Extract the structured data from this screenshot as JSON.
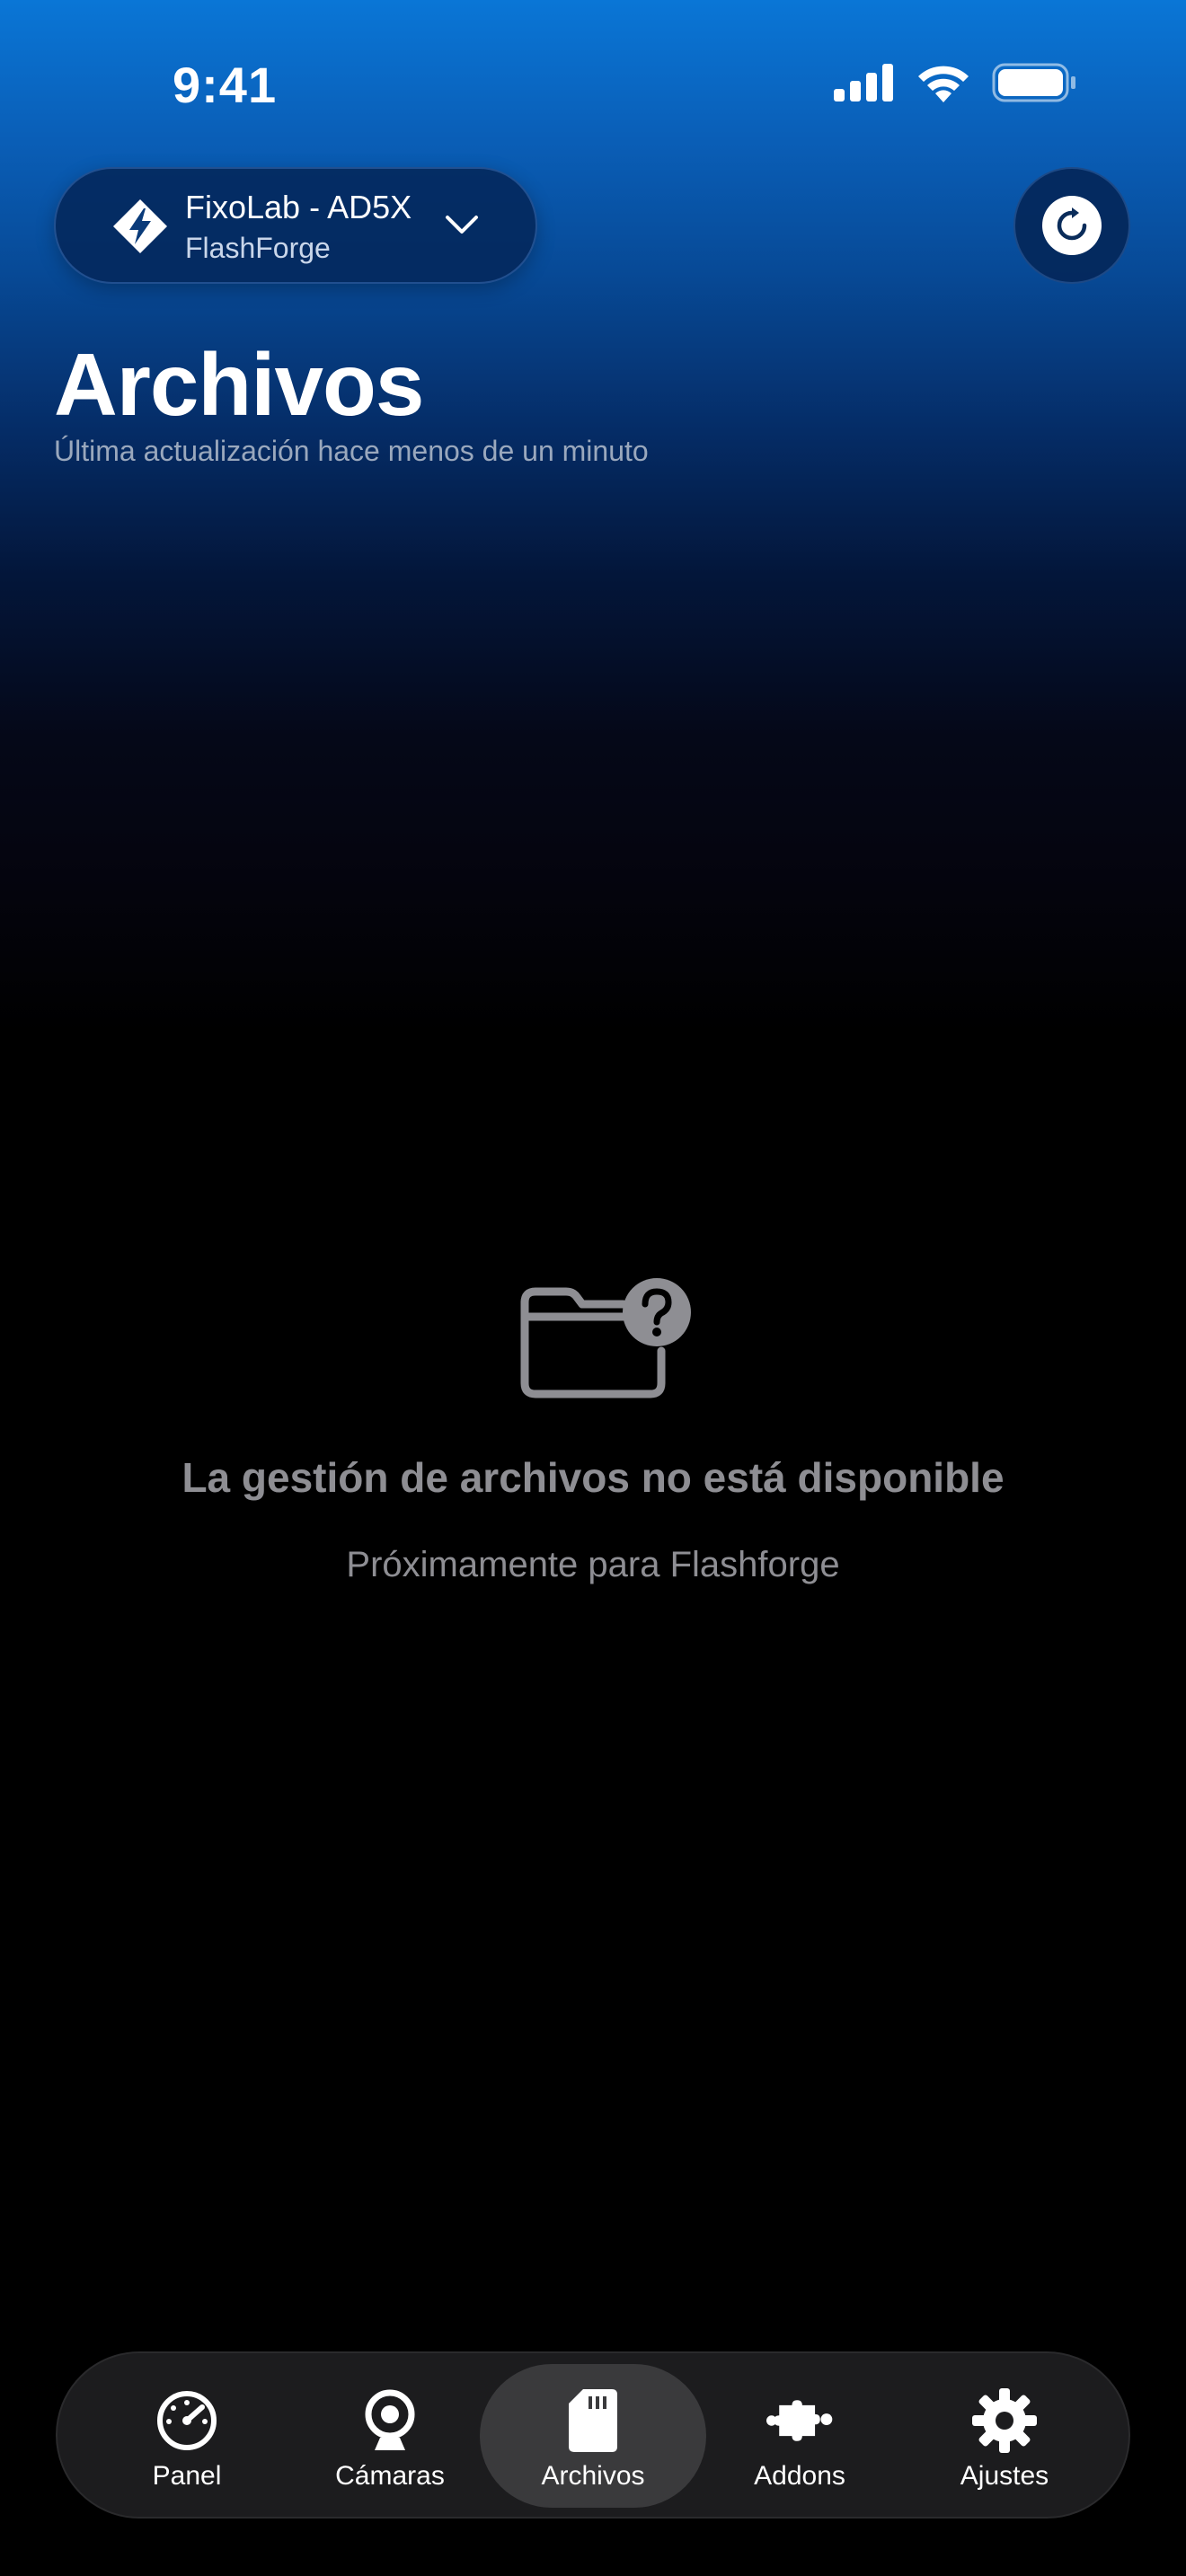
{
  "status_bar": {
    "time": "9:41",
    "icons": [
      "cellular-signal-icon",
      "wifi-icon",
      "battery-icon"
    ]
  },
  "printer_selector": {
    "name": "FixoLab - AD5X",
    "brand": "FlashForge",
    "logo_icon": "flashforge-logo-icon",
    "chevron_icon": "chevron-down-icon"
  },
  "refresh": {
    "icon": "refresh-icon"
  },
  "page": {
    "title": "Archivos",
    "subtitle": "Última actualización hace menos de un minuto"
  },
  "empty_state": {
    "icon": "folder-question-icon",
    "title": "La gestión de archivos no está disponible",
    "subtitle": "Próximamente para Flashforge"
  },
  "tab_bar": {
    "active_tab": "Archivos",
    "tabs": [
      {
        "label": "Panel",
        "icon": "speedometer-icon"
      },
      {
        "label": "Cámaras",
        "icon": "webcam-icon"
      },
      {
        "label": "Archivos",
        "icon": "sd-card-icon"
      },
      {
        "label": "Addons",
        "icon": "puzzle-icon"
      },
      {
        "label": "Ajustes",
        "icon": "gear-icon"
      }
    ]
  },
  "colors": {
    "gradient_top": "#0a76d6",
    "background": "#000000",
    "muted_text": "#8e8e93",
    "tab_bar_bg": "#1c1c1e",
    "tab_active_bg": "#3a3a3c"
  }
}
